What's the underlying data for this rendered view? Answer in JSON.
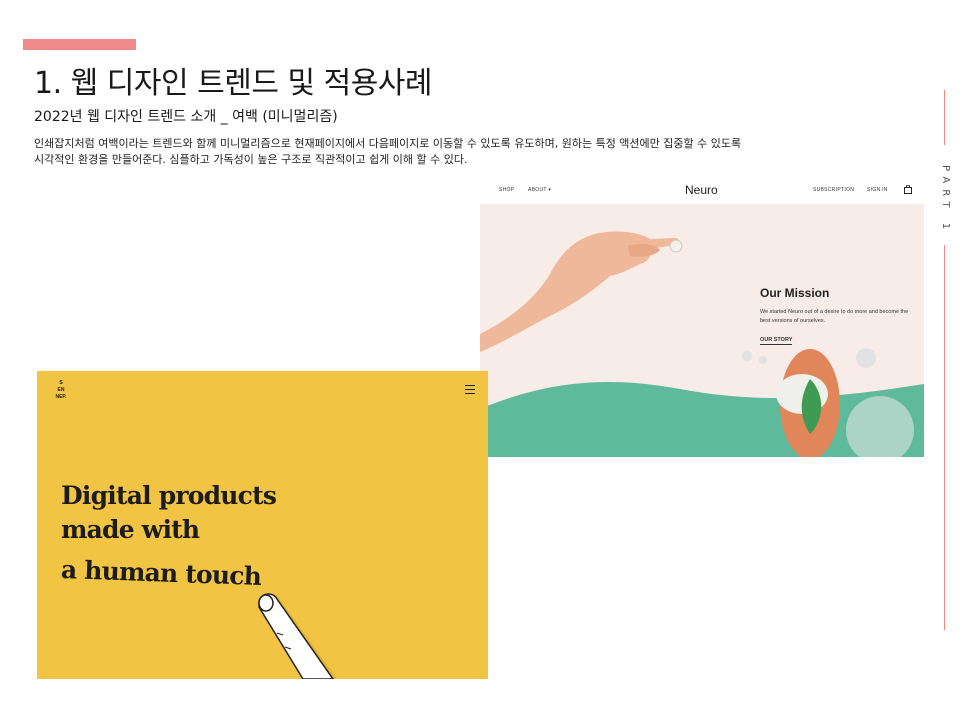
{
  "slide": {
    "title": "1. 웹 디자인 트렌드 및 적용사례",
    "subtitle": "2022년 웹 디자인 트렌드 소개 _ 여백 (미니멀리즘)",
    "body": "인쇄잡지처럼 여백이라는 트렌드와 함께 미니멀리즘으로  현재페이지에서 다음페이지로 이동할 수 있도록 유도하며, 원하는 특정 액션에만 집중할 수 있도록\n시각적인 환경을 만들어준다. 심플하고 가독성이 높은 구조로 직관적이고 쉽게 이해 할 수 있다.",
    "side_label": "PART 1",
    "accent_color": "#f08a8a"
  },
  "neuro": {
    "nav": {
      "shop": "SHOP",
      "about": "ABOUT",
      "logo": "Neuro",
      "subscription": "SUBSCRIPTION",
      "sign_in": "SIGN IN"
    },
    "mission_title": "Our Mission",
    "mission_text": "We started Neuro out of a desire to do more and become the best versions of ourselves.",
    "mission_link": "OUR STORY",
    "colors": {
      "hero_bg": "#f8ece8",
      "wave": "#5fb99b"
    }
  },
  "senep": {
    "logo_lines": [
      "S",
      "EN",
      "NEP."
    ],
    "headline": [
      "Digital products",
      "made with",
      "a human touch"
    ],
    "colors": {
      "bg": "#f2c443"
    }
  }
}
